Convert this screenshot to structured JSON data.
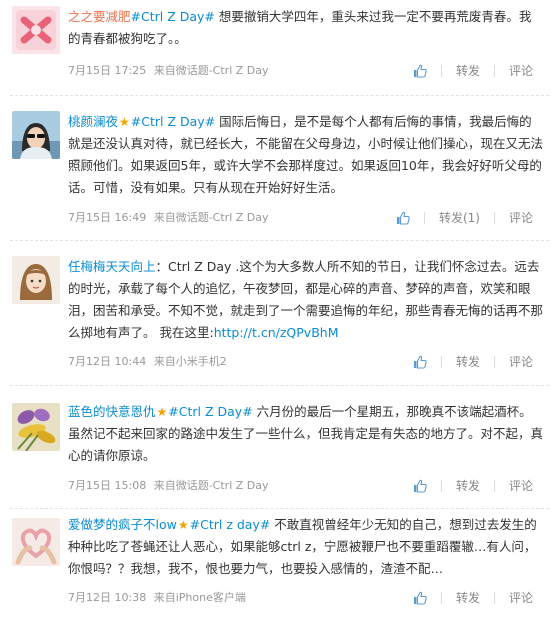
{
  "posts": [
    {
      "username": "之之要减肥",
      "badge": "",
      "topic": "#Ctrl Z Day#",
      "text": " 想要撤销大学四年，重头来过我一定不要再荒废青春。我的青春都被狗吃了。。",
      "link": "",
      "time": "7月15日 17:25",
      "source": "来自微话题-Ctrl Z Day",
      "repost_label": "转发",
      "comment_label": "评论",
      "avatar_icon": "bunny-avatar-icon",
      "avatar_color": "#e8637a"
    },
    {
      "username": "桃颜澜夜",
      "badge": "★",
      "topic": "#Ctrl Z Day#",
      "text": " 国际后悔日，是不是每个人都有后悔的事情，我最后悔的就是还没认真对待，就已经长大，不能留在父母身边，小时候让他们操心，现在又无法照顾他们。如果返回5年，或许大学不会那样度过。如果返回10年，我会好好听父母的话。可惜，没有如果。只有从现在开始好好生活。",
      "link": "",
      "time": "7月15日 16:49",
      "source": "来自微话题-Ctrl Z Day",
      "repost_label": "转发(1)",
      "comment_label": "评论",
      "avatar_icon": "person-sunglasses-avatar-icon",
      "avatar_color": "#8fb6c9"
    },
    {
      "username": "任梅梅天天向上",
      "badge": "",
      "topic": "",
      "text": "：Ctrl Z Day .这个为大多数人所不知的节日，让我们怀念过去。远去的时光，承载了每个人的追忆，午夜梦回，都是心碎的声音、梦碎的声音，欢笑和眼泪，困苦和承受。不知不觉，就走到了一个需要追悔的年纪，那些青春无悔的话再不那么掷地有声了。 我在这里:",
      "link": "http://t.cn/zQPvBhM",
      "time": "7月12日 10:44",
      "source": "来自小米手机2",
      "repost_label": "转发",
      "comment_label": "评论",
      "avatar_icon": "girl-avatar-icon",
      "avatar_color": "#d9b48f"
    },
    {
      "username": "蓝色的快意恩仇",
      "badge": "★",
      "topic": "#Ctrl Z Day#",
      "text": " 六月份的最后一个星期五，那晚真不该端起酒杯。虽然记不起来回家的路途中发生了一些什么，但我肯定是有失态的地方了。对不起，真心的请你原谅。",
      "link": "",
      "time": "7月15日 15:08",
      "source": "来自微话题-Ctrl Z Day",
      "repost_label": "转发",
      "comment_label": "评论",
      "avatar_icon": "flower-avatar-icon",
      "avatar_color": "#7a5aa0"
    },
    {
      "username": "爱做梦的疯子不low",
      "badge": "★",
      "topic": "#Ctrl z day#",
      "text": " 不敢直视曾经年少无知的自己，想到过去发生的种种比吃了苍蝇还让人恶心，如果能够ctrl z，宁愿被鞭尸也不要重蹈覆辙…有人问，你恨吗？？我想，我不，恨也要力气，也要投入感情的，渣渣不配…",
      "link": "",
      "time": "7月12日 10:38",
      "source": "来自iPhone客户端",
      "repost_label": "转发",
      "comment_label": "评论",
      "avatar_icon": "heart-hands-avatar-icon",
      "avatar_color": "#e9a0a8"
    }
  ],
  "colors": {
    "username": "#eb7350",
    "username_blue": "#0a8cd2",
    "topic": "#0a8cd2",
    "meta": "#999999"
  },
  "icons": {
    "like": "thumbs-up-icon"
  }
}
